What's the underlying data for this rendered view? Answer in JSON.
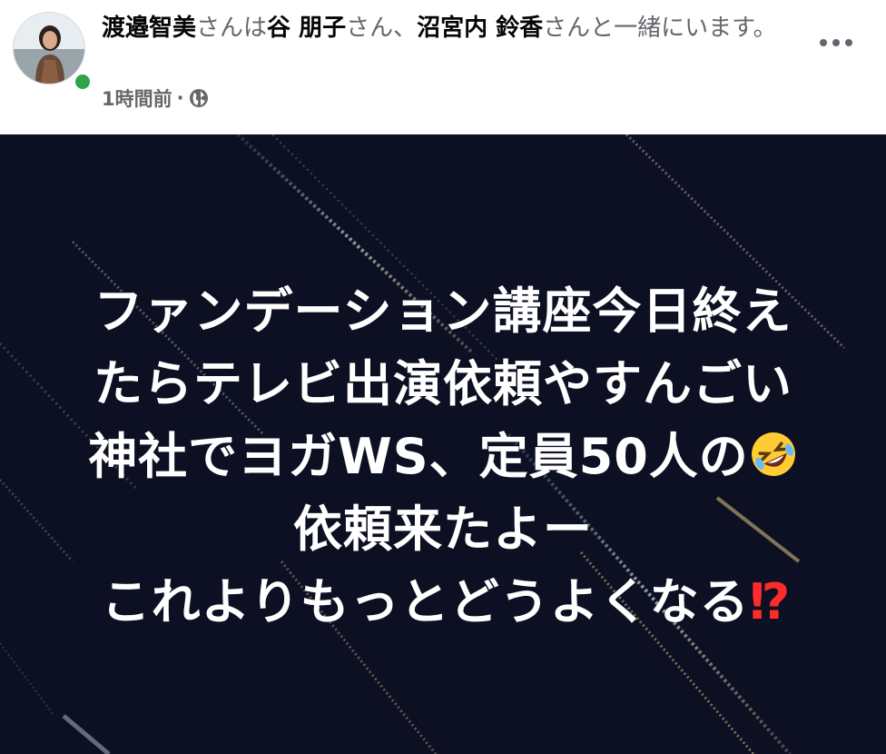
{
  "post": {
    "author": "渡邉智美",
    "text_with": "さんは",
    "tagged_1": "谷 朋子",
    "text_and": "さん、",
    "tagged_2": "沼宮内 鈴香",
    "text_end": "さんと一緒にいます。",
    "time": "1時間前",
    "separator": "·",
    "privacy_icon": "globe-icon",
    "more_icon": "ellipsis-icon"
  },
  "image_text": {
    "line1": "ファンデーション講座今日終え",
    "line2": "たらテレビ出演依頼やすんごい",
    "line3": "神社でヨガWS、定員50人の",
    "line3_emoji": "rolling-on-floor-laughing-emoji",
    "line4": "依頼来たよー",
    "line5": "これよりもっとどうよくなる",
    "line5_emoji": "⁉"
  },
  "colors": {
    "author": "#050505",
    "secondary_text": "#65676b",
    "online": "#31a24c",
    "image_background": "#0d1023",
    "image_text": "#ffffff",
    "interrobang": "#ff2b2b"
  }
}
